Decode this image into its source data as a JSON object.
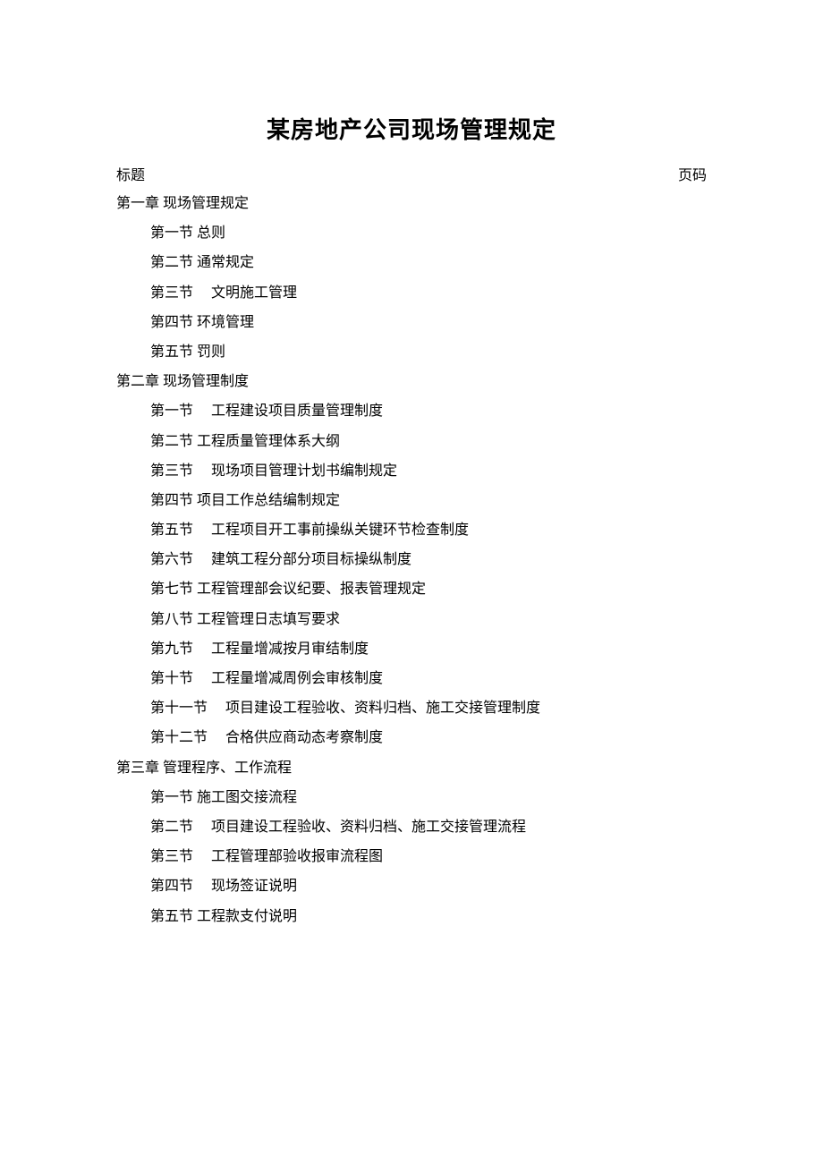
{
  "title": "某房地产公司现场管理规定",
  "header": {
    "left": "标题",
    "right": "页码"
  },
  "toc": [
    {
      "chapter": "第一章  现场管理规定",
      "sections": [
        "第一节  总则",
        "第二节  通常规定",
        "第三节　 文明施工管理",
        "第四节  环境管理",
        "第五节  罚则"
      ]
    },
    {
      "chapter": "第二章  现场管理制度",
      "sections": [
        "第一节　 工程建设项目质量管理制度",
        "第二节  工程质量管理体系大纲",
        "第三节　 现场项目管理计划书编制规定",
        "第四节  项目工作总结编制规定",
        "第五节　 工程项目开工事前操纵关键环节检查制度",
        "第六节　 建筑工程分部分项目标操纵制度",
        "第七节  工程管理部会议纪要、报表管理规定",
        "第八节  工程管理日志填写要求",
        "第九节　 工程量增减按月审结制度",
        "第十节　 工程量增减周例会审核制度",
        "第十一节　 项目建设工程验收、资料归档、施工交接管理制度",
        "第十二节　 合格供应商动态考察制度"
      ]
    },
    {
      "chapter": "第三章  管理程序、工作流程",
      "sections": [
        "第一节  施工图交接流程",
        "第二节　 项目建设工程验收、资料归档、施工交接管理流程",
        "第三节　 工程管理部验收报审流程图",
        "第四节　 现场签证说明",
        "第五节  工程款支付说明"
      ]
    }
  ]
}
